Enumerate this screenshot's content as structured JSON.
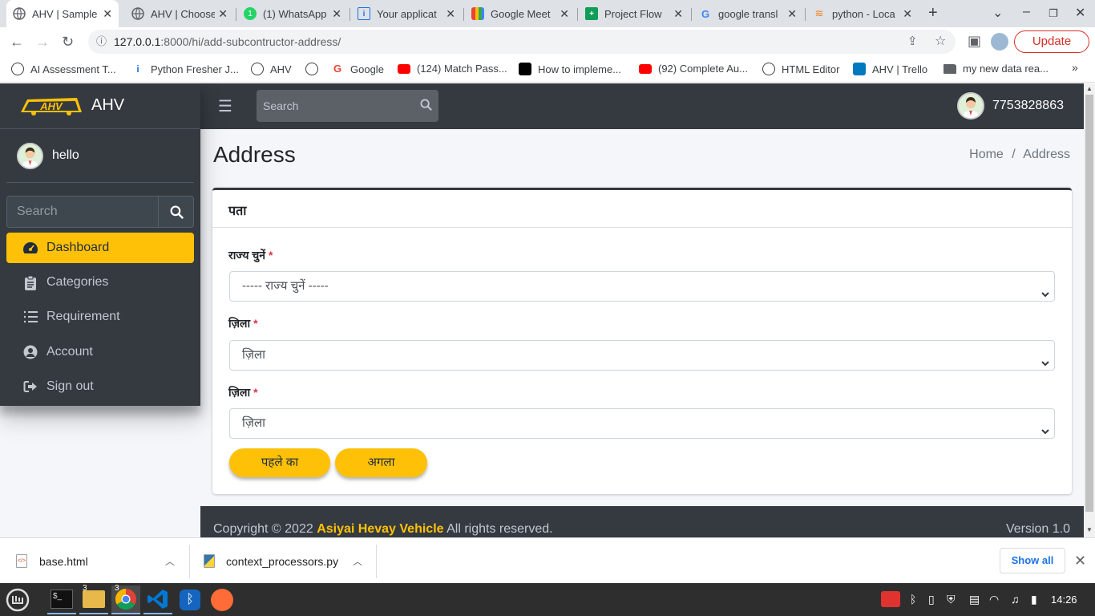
{
  "browser": {
    "tabs": [
      {
        "title": "AHV | Sample",
        "icon": "globe-icon",
        "active": true
      },
      {
        "title": "AHV | Choose",
        "icon": "globe-icon"
      },
      {
        "title": "(1) WhatsApp",
        "icon": "whatsapp-icon"
      },
      {
        "title": "Your applicat",
        "icon": "info-icon"
      },
      {
        "title": "Google Meet",
        "icon": "meet-icon"
      },
      {
        "title": "Project Flow",
        "icon": "sheets-icon"
      },
      {
        "title": "google transl",
        "icon": "google-icon"
      },
      {
        "title": "python - Loca",
        "icon": "stackoverflow-icon"
      }
    ],
    "url_host": "127.0.0.1",
    "url_path": ":8000/hi/add-subcontructor-address/",
    "update_label": "Update",
    "bookmarks": [
      {
        "label": "AI Assessment T...",
        "icon": "globe-icon"
      },
      {
        "label": "Python Fresher J...",
        "icon": "info-icon"
      },
      {
        "label": "AHV",
        "icon": "globe-icon"
      },
      {
        "label": "",
        "icon": "globe-icon"
      },
      {
        "label": "Google",
        "icon": "google-icon"
      },
      {
        "label": "(124) Match Pass...",
        "icon": "youtube-icon"
      },
      {
        "label": "How to impleme...",
        "icon": "medium-icon"
      },
      {
        "label": "(92) Complete Au...",
        "icon": "youtube-icon"
      },
      {
        "label": "HTML Editor",
        "icon": "globe-icon"
      },
      {
        "label": "AHV | Trello",
        "icon": "trello-icon"
      },
      {
        "label": "my new data rea...",
        "icon": "folder-icon"
      }
    ]
  },
  "app": {
    "brand": "AHV",
    "nav_search_placeholder": "Search",
    "user_phone": "7753828863",
    "sidebar": {
      "user_name": "hello",
      "search_placeholder": "Search",
      "items": [
        {
          "label": "Dashboard",
          "icon": "dashboard-icon",
          "active": true
        },
        {
          "label": "Categories",
          "icon": "clipboard-icon"
        },
        {
          "label": "Requirement",
          "icon": "list-icon"
        },
        {
          "label": "Account",
          "icon": "user-circle-icon"
        },
        {
          "label": "Sign out",
          "icon": "sign-out-icon"
        }
      ]
    },
    "page_title": "Address",
    "breadcrumb": {
      "home": "Home",
      "separator": "/",
      "current": "Address"
    },
    "card": {
      "title": "पता",
      "fields": [
        {
          "label": "राज्य चुनें",
          "required_mark": "*",
          "value": "----- राज्य चुनें -----"
        },
        {
          "label": "ज़िला",
          "required_mark": "*",
          "value": "ज़िला"
        },
        {
          "label": "ज़िला",
          "required_mark": "*",
          "value": "ज़िला"
        }
      ],
      "prev_label": "पहले का",
      "next_label": "अगला"
    },
    "footer": {
      "copyright": "Copyright © 2022",
      "company": "Asiyai Hevay Vehicle",
      "rights": "All rights reserved.",
      "version": "Version 1.0"
    }
  },
  "downloads": {
    "items": [
      {
        "name": "base.html",
        "icon": "html-file-icon"
      },
      {
        "name": "context_processors.py",
        "icon": "python-file-icon"
      }
    ],
    "show_all": "Show all"
  },
  "taskbar": {
    "clock": "14:26",
    "badges": {
      "files": "3",
      "chrome": "3"
    }
  },
  "colors": {
    "accent": "#ffc107",
    "dark": "#343a40",
    "required": "#dc3545"
  }
}
